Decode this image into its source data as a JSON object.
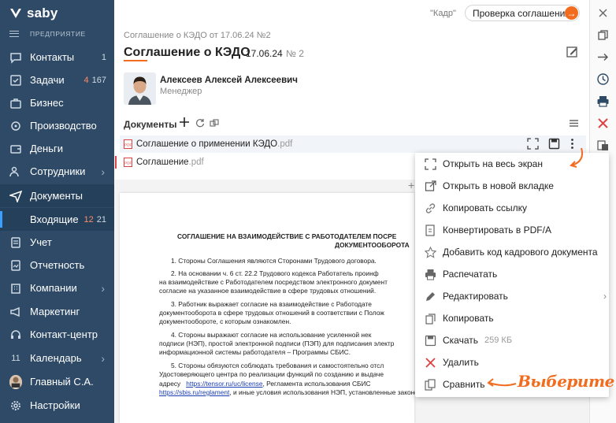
{
  "app": {
    "logo_text": "saby",
    "org_label": "ПРЕДПРИЯТИЕ"
  },
  "sidebar": {
    "items": [
      {
        "label": "Контакты",
        "count": "1",
        "icon": "chat-icon"
      },
      {
        "label": "Задачи",
        "count_red": "4",
        "count": "167",
        "icon": "tasks-icon"
      },
      {
        "label": "Бизнес",
        "icon": "briefcase-icon"
      },
      {
        "label": "Производство",
        "icon": "factory-icon"
      },
      {
        "label": "Деньги",
        "icon": "money-icon"
      },
      {
        "label": "Сотрудники",
        "icon": "people-icon",
        "has_submenu": true
      },
      {
        "label": "Документы",
        "icon": "send-icon",
        "active": true
      },
      {
        "label": "Входящие",
        "count_red": "12",
        "count": "21",
        "sub": true
      },
      {
        "label": "Учет",
        "icon": "ledger-icon"
      },
      {
        "label": "Отчетность",
        "icon": "report-icon"
      },
      {
        "label": "Компании",
        "icon": "building-icon",
        "has_submenu": true
      },
      {
        "label": "Маркетинг",
        "icon": "megaphone-icon"
      },
      {
        "label": "Контакт-центр",
        "icon": "headset-icon"
      },
      {
        "label": "Календарь",
        "icon": "calendar-icon",
        "day": "11",
        "has_submenu": true
      },
      {
        "label": "Главный С.А.",
        "icon": "user-avatar"
      },
      {
        "label": "Настройки",
        "icon": "gear-icon"
      }
    ]
  },
  "header": {
    "kadr_label": "\"Кадр\"",
    "check_button": "Проверка соглашения"
  },
  "document": {
    "breadcrumb": "Соглашение о КЭДО от 17.06.24 №2",
    "title": "Соглашение о КЭДО",
    "date": "17.06.24",
    "number": "№ 2"
  },
  "person": {
    "name": "Алексеев Алексей Алексеевич",
    "role": "Менеджер"
  },
  "documents": {
    "heading": "Документы",
    "files": [
      {
        "name": "Соглашение о применении КЭДО",
        "ext": ".pdf"
      },
      {
        "name": "Соглашение",
        "ext": ".pdf"
      }
    ]
  },
  "preview": {
    "heading1": "СОГЛАШЕНИЕ НА ВЗАИМОДЕЙСТВИЕ С РАБОТОДАТЕЛЕМ ПОСРЕ",
    "heading2": "ДОКУМЕНТООБОРОТА",
    "lines": [
      "1. Стороны Соглашения являются Сторонами Трудового договора.",
      "2. На основании ч. 6 ст. 22.2 Трудового кодекса Работатель проинф",
      "на взаимодействие с Работодателем посредством электронного документ",
      "согласие на указанное взаимодействие в сфере трудовых отношений.",
      "3. Работник выражает согласие на взаимодействие с Работодате",
      "документооборота в сфере трудовых отношений в соответствии с Полож",
      "документообороте, с которым ознакомлен.",
      "4. Стороны выражают согласие на использование усиленной нек",
      "подписи (НЭП), простой электронной подписи (ПЭП) для подписания электр",
      "информационной системы работодателя – Программы СБИС.",
      "5. Стороны обязуются соблюдать требования и самостоятельно отсл",
      "Удостоверяющего центра по реализации функций по созданию и выдаче",
      "адресу",
      "https://tensor.ru/uc/license",
      ", Регламента использования СБИС",
      "https://sbis.ru/reglament",
      ", и иные условия использования НЭП, установленные законодательством РФ."
    ]
  },
  "menu": {
    "items": [
      {
        "label": "Открыть на весь экран",
        "icon": "fullscreen-icon"
      },
      {
        "label": "Открыть в новой вкладке",
        "icon": "external-link-icon"
      },
      {
        "label": "Копировать ссылку",
        "icon": "link-icon"
      },
      {
        "label": "Конвертировать в PDF/A",
        "icon": "convert-icon"
      },
      {
        "label": "Добавить код кадрового документа",
        "icon": "star-icon"
      },
      {
        "label": "Распечатать",
        "icon": "print-icon"
      },
      {
        "label": "Редактировать",
        "icon": "pencil-icon",
        "has_submenu": true
      },
      {
        "label": "Копировать",
        "icon": "copy-icon"
      },
      {
        "label": "Скачать",
        "sub": "259 КБ",
        "icon": "download-icon"
      },
      {
        "label": "Удалить",
        "icon": "delete-icon"
      },
      {
        "label": "Сравнить",
        "icon": "compare-icon"
      }
    ]
  },
  "annotation": {
    "text": "Выберите"
  },
  "colors": {
    "sidebar": "#2e4a66",
    "accent": "#f26c1f",
    "link": "#1a3db5",
    "danger": "#e04040"
  }
}
